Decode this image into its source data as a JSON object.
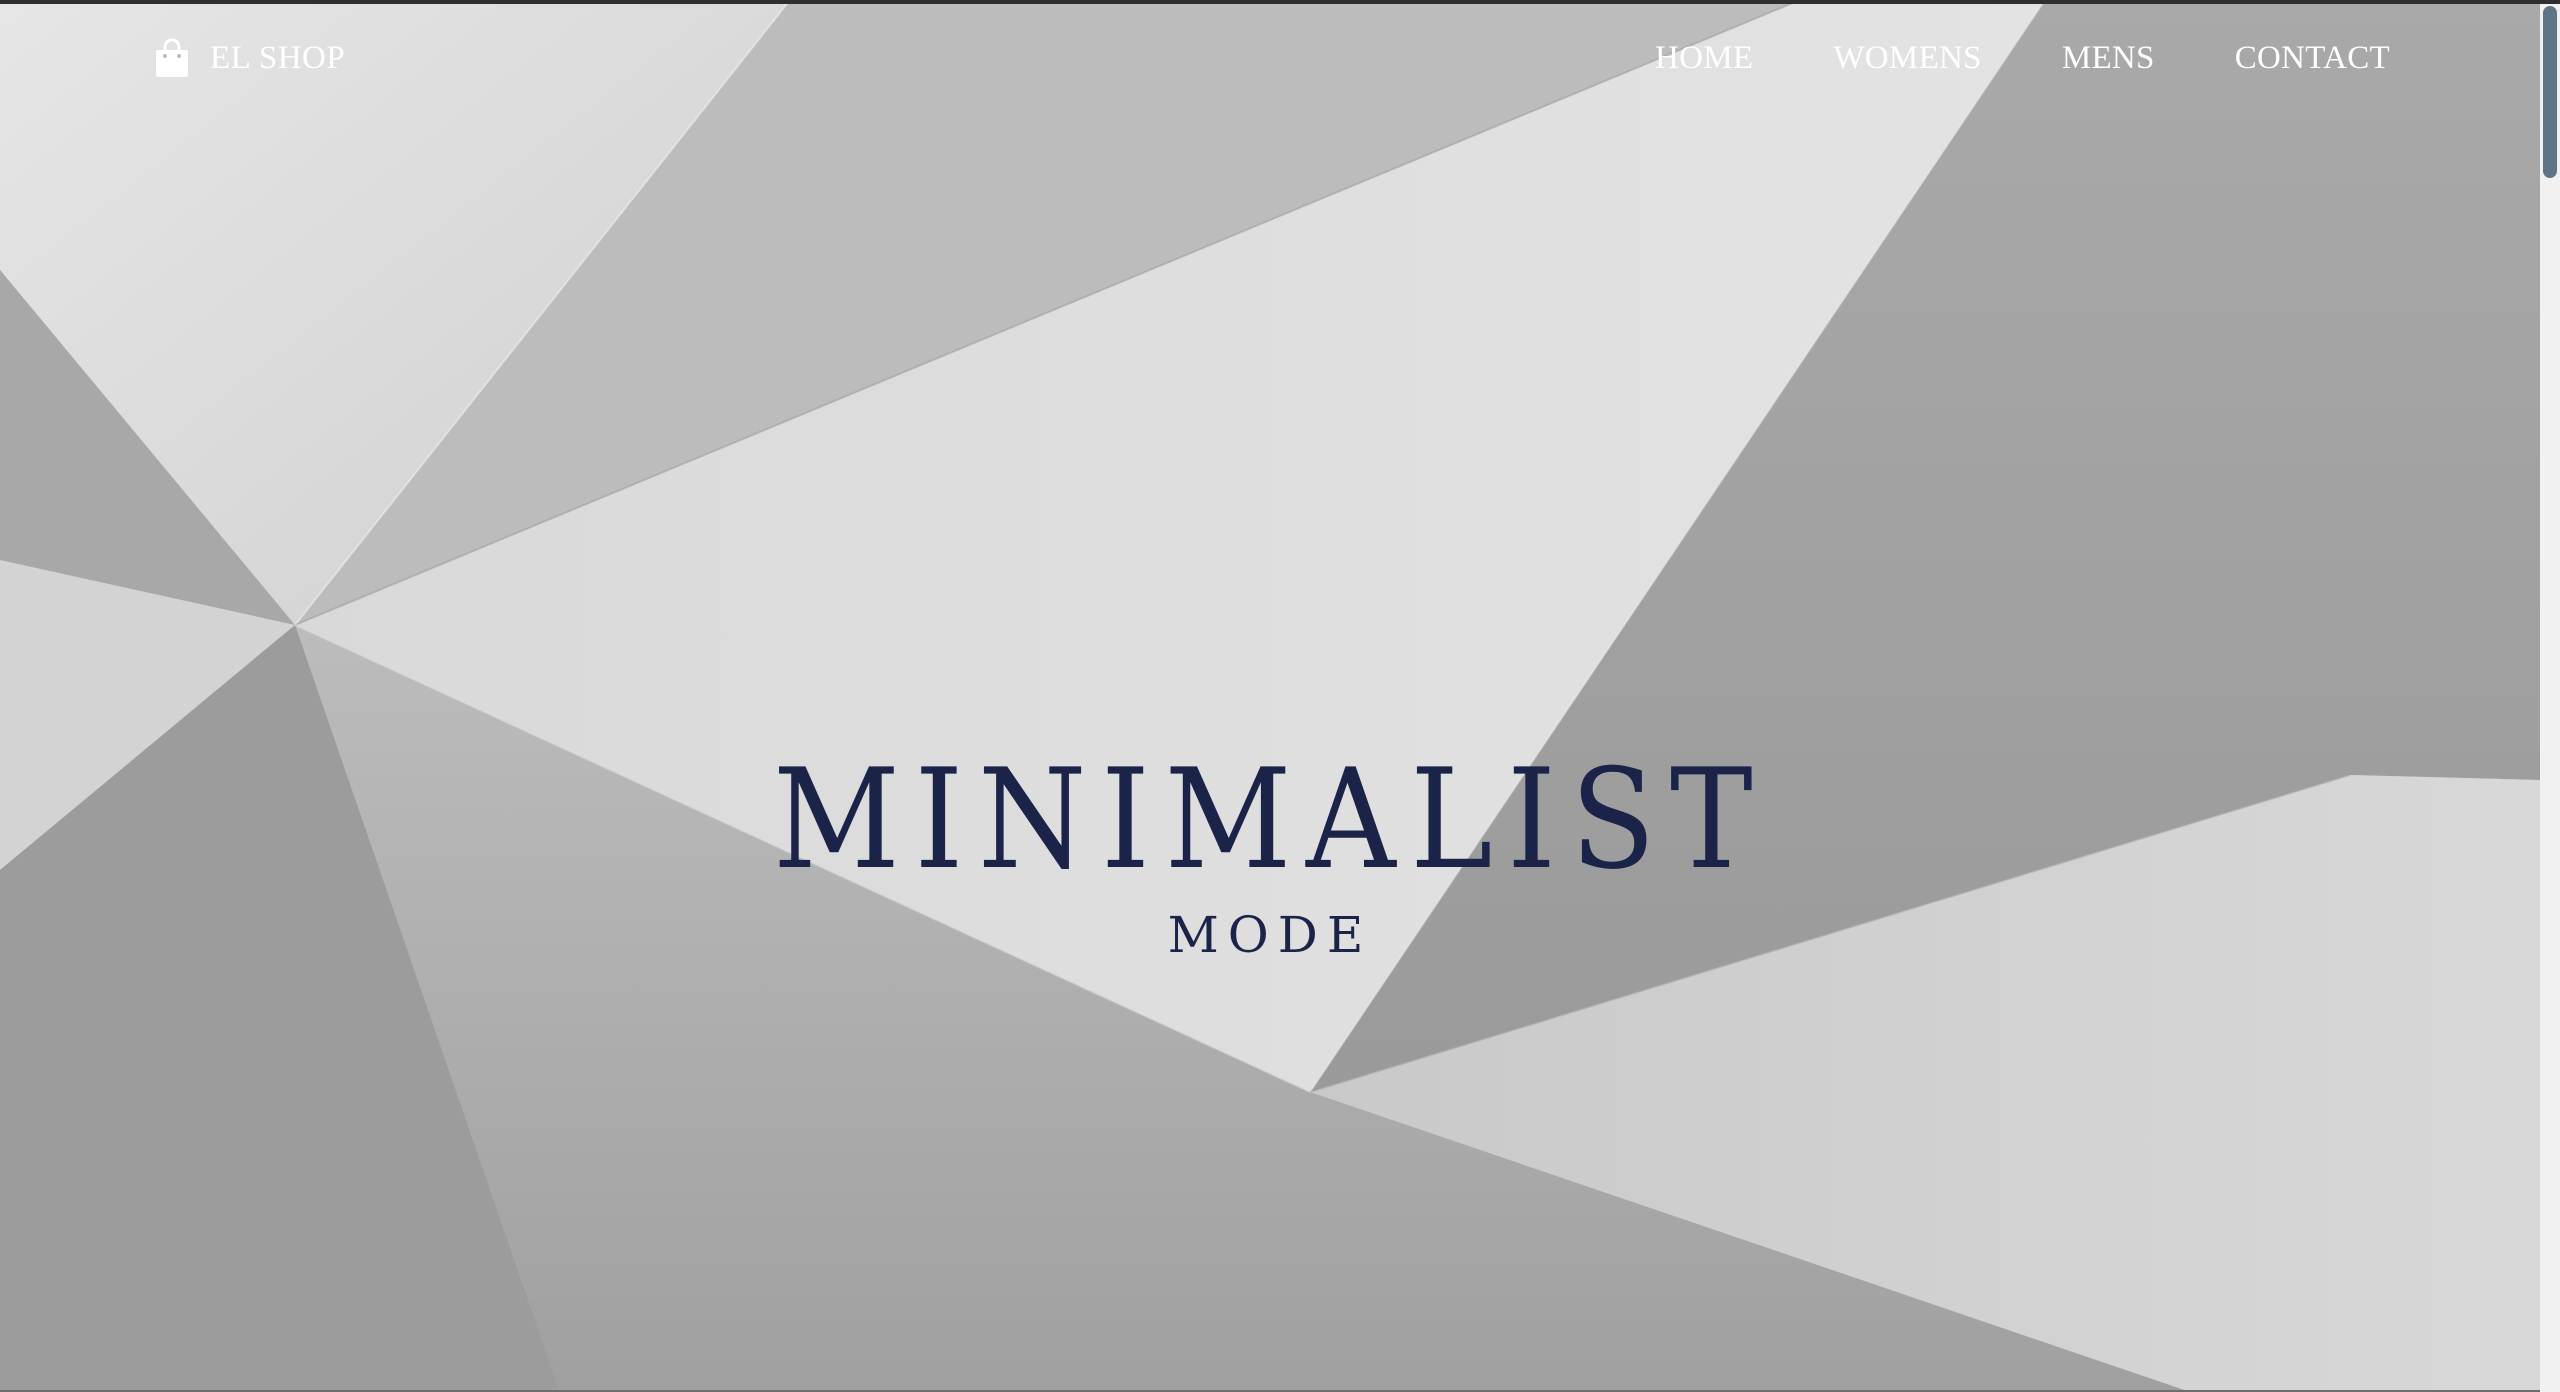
{
  "brand": {
    "name": "EL SHOP",
    "icon": "shopping-bag-icon"
  },
  "nav": {
    "items": [
      {
        "label": "HOME"
      },
      {
        "label": "WOMENS"
      },
      {
        "label": "MENS"
      },
      {
        "label": "CONTACT"
      }
    ]
  },
  "hero": {
    "title": "MINIMALIST",
    "subtitle": "MODE",
    "title_color": "#1b2448",
    "background": "grey low-poly geometric folds"
  },
  "scrollbar": {
    "thumb_color": "#5f7585"
  }
}
